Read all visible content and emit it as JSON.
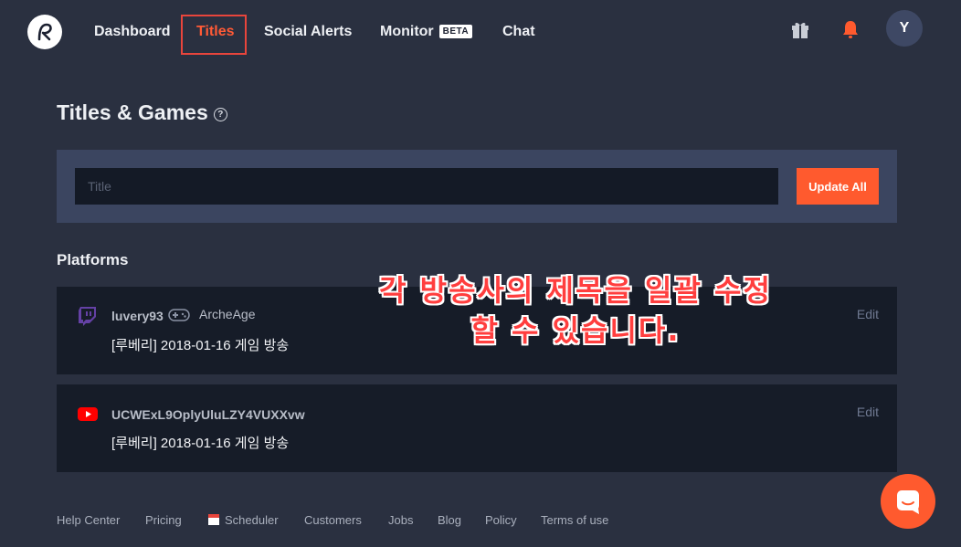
{
  "nav": {
    "items": [
      {
        "label": "Dashboard"
      },
      {
        "label": "Titles"
      },
      {
        "label": "Social Alerts"
      },
      {
        "label": "Monitor",
        "badge": "BETA"
      },
      {
        "label": "Chat"
      }
    ],
    "avatar_initial": "Y",
    "icons": [
      "gift-icon",
      "bell-icon"
    ]
  },
  "page": {
    "title": "Titles & Games",
    "help_glyph": "?"
  },
  "title_panel": {
    "input_placeholder": "Title",
    "input_value": "",
    "update_button": "Update All"
  },
  "platforms": {
    "heading": "Platforms",
    "items": [
      {
        "platform": "twitch",
        "username": "luvery93",
        "game": "ArcheAge",
        "title": "[루베리] 2018-01-16 게임 방송",
        "edit": "Edit"
      },
      {
        "platform": "youtube",
        "username": "UCWExL9OplyUluLZY4VUXXvw",
        "game": "",
        "title": "[루베리] 2018-01-16 게임 방송",
        "edit": "Edit"
      }
    ]
  },
  "annotation": {
    "line1": "각 방송사의 제목을 일괄 수정",
    "line2": "할 수 있습니다."
  },
  "footer": {
    "links": [
      "Help Center",
      "Pricing",
      "Scheduler",
      "Customers",
      "Jobs",
      "Blog",
      "Policy",
      "Terms of use"
    ]
  },
  "colors": {
    "background": "#2a3040",
    "accent": "#ff5a2e",
    "twitch": "#6441a5",
    "youtube": "#ff0000"
  }
}
